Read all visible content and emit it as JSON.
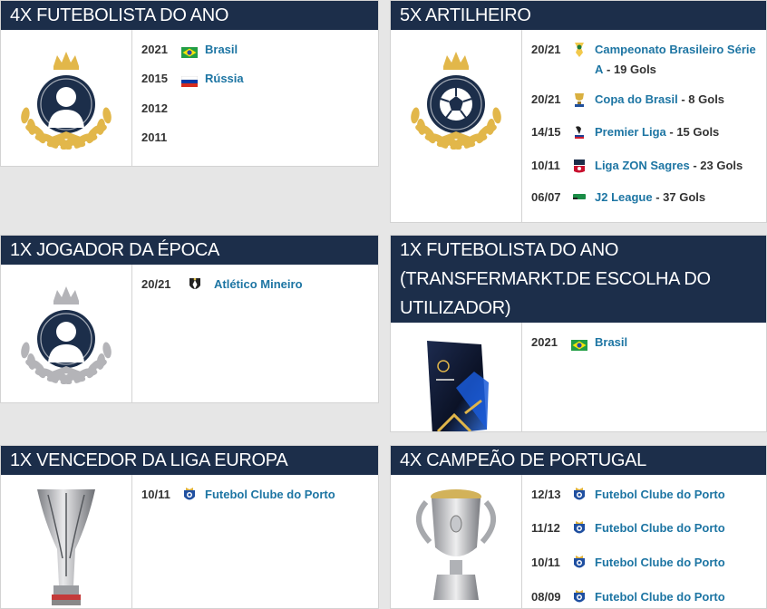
{
  "boxes": [
    {
      "title": "4X FUTEBOLISTA DO ANO",
      "image": "gold-laurel-person-icon",
      "rows": [
        {
          "season": "2021",
          "flag": "brazil",
          "name": "Brasil"
        },
        {
          "season": "2015",
          "flag": "russia",
          "name": "Rússia"
        },
        {
          "season": "2012"
        },
        {
          "season": "2011"
        }
      ]
    },
    {
      "title": "5X ARTILHEIRO",
      "image": "gold-laurel-ball-icon",
      "rows": [
        {
          "season": "20/21",
          "icon": "brasileirao-logo-icon",
          "name": "Campeonato Brasileiro Série A",
          "extra": " - 19 Gols"
        },
        {
          "season": "20/21",
          "icon": "copa-do-brasil-logo-icon",
          "name": "Copa do Brasil",
          "extra": " - 8 Gols"
        },
        {
          "season": "14/15",
          "icon": "premier-liga-logo-icon",
          "name": "Premier Liga",
          "extra": " - 15 Gols"
        },
        {
          "season": "10/11",
          "icon": "liga-zon-sagres-logo-icon",
          "name": "Liga ZON Sagres",
          "extra": " - 23 Gols"
        },
        {
          "season": "06/07",
          "icon": "j2-league-logo-icon",
          "name": "J2 League",
          "extra": " - 37 Gols"
        }
      ]
    },
    {
      "title": "1X JOGADOR DA ÉPOCA",
      "image": "silver-laurel-person-icon",
      "rows": [
        {
          "season": "20/21",
          "icon": "atletico-mineiro-crest-icon",
          "name": "Atlético Mineiro"
        }
      ]
    },
    {
      "title": "1X FUTEBOLISTA DO ANO (TRANSFERMARKT.DE ESCOLHA DO UTILIZADOR)",
      "image": "transfermarkt-trophy-icon",
      "rows": [
        {
          "season": "2021",
          "flag": "brazil",
          "name": "Brasil"
        }
      ]
    },
    {
      "title": "1X VENCEDOR DA LIGA EUROPA",
      "image": "europa-league-trophy-icon",
      "rows": [
        {
          "season": "10/11",
          "icon": "fc-porto-crest-icon",
          "name": "Futebol Clube do Porto"
        }
      ]
    },
    {
      "title": "4X CAMPEÃO DE PORTUGAL",
      "image": "portuguese-league-trophy-icon",
      "rows": [
        {
          "season": "12/13",
          "icon": "fc-porto-crest-icon",
          "name": "Futebol Clube do Porto"
        },
        {
          "season": "11/12",
          "icon": "fc-porto-crest-icon",
          "name": "Futebol Clube do Porto"
        },
        {
          "season": "10/11",
          "icon": "fc-porto-crest-icon",
          "name": "Futebol Clube do Porto"
        },
        {
          "season": "08/09",
          "icon": "fc-porto-crest-icon",
          "name": "Futebol Clube do Porto"
        }
      ]
    }
  ],
  "colors": {
    "header": "#1c2e4a",
    "link": "#1d75a3",
    "gold": "#e2b74a",
    "silver": "#b4b4b8"
  }
}
